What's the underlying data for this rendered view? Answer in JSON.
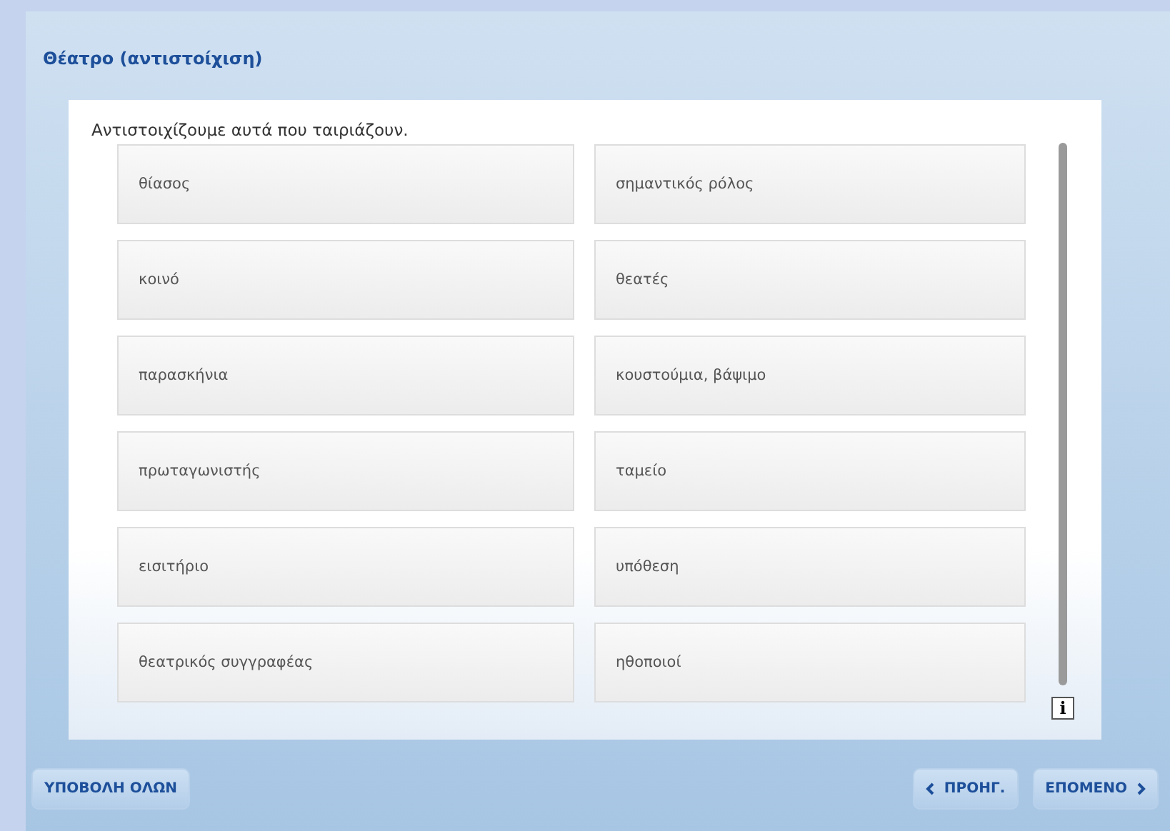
{
  "title": "Θέατρο (αντιστοίχιση)",
  "instruction": "Αντιστοιχίζουμε αυτά που ταιριάζουν.",
  "pairs": [
    {
      "left": "θίασος",
      "right": "σημαντικός ρόλος"
    },
    {
      "left": "κοινό",
      "right": "θεατές"
    },
    {
      "left": "παρασκήνια",
      "right": "κουστούμια, βάψιμο"
    },
    {
      "left": "πρωταγωνιστής",
      "right": "ταμείο"
    },
    {
      "left": "εισιτήριο",
      "right": "υπόθεση"
    },
    {
      "left": "θεατρικός συγγραφέας",
      "right": "ηθοποιοί"
    }
  ],
  "info_label": "i",
  "buttons": {
    "submit": "ΥΠΟΒΟΛΗ ΟΛΩΝ",
    "previous": "ΠΡΟΗΓ.",
    "next": "ΕΠΟΜΕΝΟ"
  }
}
